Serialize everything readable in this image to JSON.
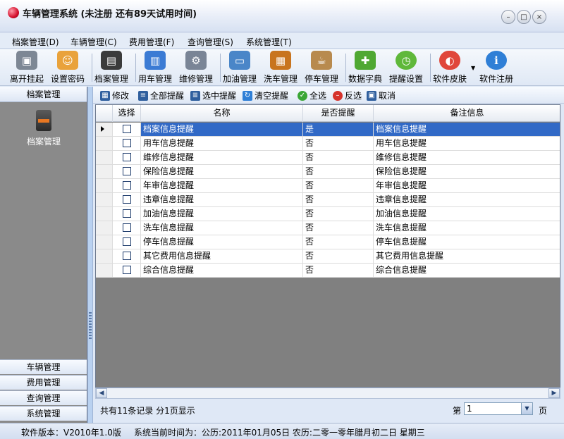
{
  "window": {
    "title": "车辆管理系统 (未注册 还有89天试用时间)",
    "controls": {
      "minimize": "–",
      "maximize": "□",
      "close": "×"
    }
  },
  "menu": [
    {
      "label": "档案管理(D)"
    },
    {
      "label": "车辆管理(C)"
    },
    {
      "label": "费用管理(F)"
    },
    {
      "label": "查询管理(S)"
    },
    {
      "label": "系统管理(T)"
    }
  ],
  "toolbar": [
    {
      "label": "离开挂起",
      "icon": "lock-icon",
      "color": "#7d8794",
      "glyph": "🔒"
    },
    {
      "label": "设置密码",
      "icon": "user-icon",
      "color": "#e9a23b",
      "glyph": "☺"
    },
    {
      "label": "档案管理",
      "icon": "binder-icon",
      "color": "#3b3b3b",
      "glyph": "▤"
    },
    {
      "label": "用车管理",
      "icon": "notebook-icon",
      "color": "#3b7bd4",
      "glyph": "▥"
    },
    {
      "label": "维修管理",
      "icon": "gear-icon",
      "color": "#7a8596",
      "glyph": "⚙"
    },
    {
      "label": "加油管理",
      "icon": "card-icon",
      "color": "#4a86c8",
      "glyph": "▭"
    },
    {
      "label": "洗车管理",
      "icon": "cabinet-icon",
      "color": "#c8741e",
      "glyph": "▦"
    },
    {
      "label": "停车管理",
      "icon": "cup-icon",
      "color": "#b88a4e",
      "glyph": "☕"
    },
    {
      "label": "数据字典",
      "icon": "puzzle-icon",
      "color": "#4fa832",
      "glyph": "✚"
    },
    {
      "label": "提醒设置",
      "icon": "clock-icon",
      "color": "#5fb83a",
      "glyph": "◷"
    },
    {
      "label": "软件皮肤",
      "icon": "pill-icon",
      "color": "#e0473b",
      "glyph": "◐"
    },
    {
      "label": "软件注册",
      "icon": "info-icon",
      "color": "#2f7fd6",
      "glyph": "i"
    }
  ],
  "left_panel": {
    "header": "档案管理",
    "item_label": "档案管理",
    "nav": [
      "车辆管理",
      "费用管理",
      "查询管理",
      "系统管理"
    ]
  },
  "subtoolbar": [
    {
      "label": "修改",
      "icon": "edit-icon",
      "color": "#2f5f9e"
    },
    {
      "label": "全部提醒",
      "icon": "list-icon",
      "color": "#2f5f9e"
    },
    {
      "label": "选中提醒",
      "icon": "list-check-icon",
      "color": "#2f5f9e"
    },
    {
      "label": "清空提醒",
      "icon": "refresh-icon",
      "color": "#2f7fd6"
    },
    {
      "label": "全选",
      "icon": "check-circle-icon",
      "color": "#3aa636"
    },
    {
      "label": "反选",
      "icon": "minus-circle-icon",
      "color": "#d6332c"
    },
    {
      "label": "取消",
      "icon": "lock-small-icon",
      "color": "#2f5f9e"
    }
  ],
  "grid": {
    "columns": [
      "选择",
      "名称",
      "是否提醒",
      "备注信息"
    ],
    "rows": [
      {
        "name": "档案信息提醒",
        "flag": "是",
        "note": "档案信息提醒"
      },
      {
        "name": "用车信息提醒",
        "flag": "否",
        "note": "用车信息提醒"
      },
      {
        "name": "维修信息提醒",
        "flag": "否",
        "note": "维修信息提醒"
      },
      {
        "name": "保险信息提醒",
        "flag": "否",
        "note": "保险信息提醒"
      },
      {
        "name": "年审信息提醒",
        "flag": "否",
        "note": "年审信息提醒"
      },
      {
        "name": "违章信息提醒",
        "flag": "否",
        "note": "违章信息提醒"
      },
      {
        "name": "加油信息提醒",
        "flag": "否",
        "note": "加油信息提醒"
      },
      {
        "name": "洗车信息提醒",
        "flag": "否",
        "note": "洗车信息提醒"
      },
      {
        "name": "停车信息提醒",
        "flag": "否",
        "note": "停车信息提醒"
      },
      {
        "name": "其它费用信息提醒",
        "flag": "否",
        "note": "其它费用信息提醒"
      },
      {
        "name": "综合信息提醒",
        "flag": "否",
        "note": "综合信息提醒"
      }
    ]
  },
  "pager": {
    "total": "共有11条记录 分1页显示",
    "label_prefix": "第",
    "page_value": "1",
    "label_suffix": "页"
  },
  "status": {
    "version": "软件版本：V2010年1.0版",
    "datetime": "系统当前时间为：公历:2011年01月05日 农历:二零一零年腊月初二日 星期三"
  }
}
